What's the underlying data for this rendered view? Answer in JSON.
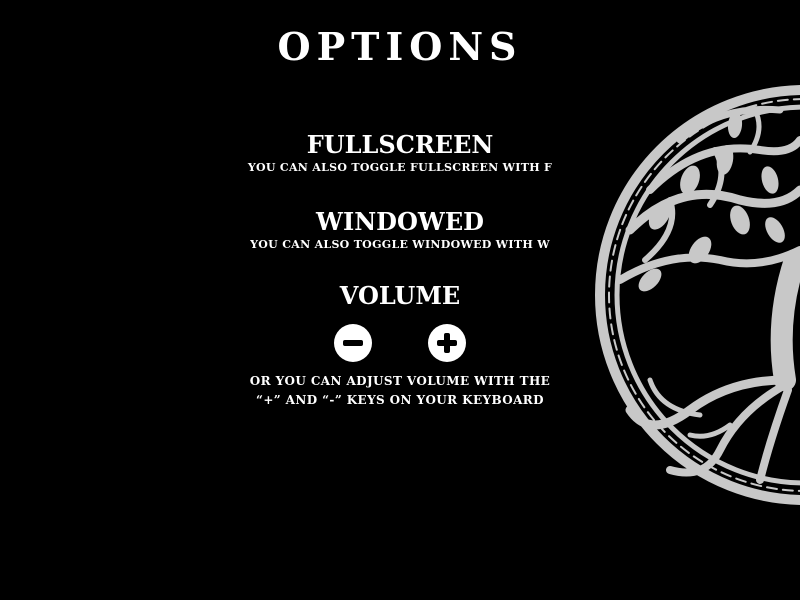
{
  "menu": {
    "title": "OPTIONS",
    "fullscreen": {
      "label": "FULLSCREEN",
      "hint": "YOU CAN ALSO TOGGLE FULLSCREEN WITH F"
    },
    "windowed": {
      "label": "WINDOWED",
      "hint": "YOU CAN ALSO TOGGLE WINDOWED WITH W"
    },
    "volume": {
      "label": "VOLUME",
      "decrease_icon": "minus-icon",
      "increase_icon": "plus-icon",
      "hint_line1": "OR YOU CAN ADJUST VOLUME WITH THE",
      "hint_line2": "“+” AND “-” KEYS ON YOUR KEYBOARD"
    }
  },
  "decoration": {
    "icon": "tree-of-life-icon",
    "color": "#c8c8c8"
  },
  "colors": {
    "background": "#000000",
    "text": "#ffffff"
  }
}
